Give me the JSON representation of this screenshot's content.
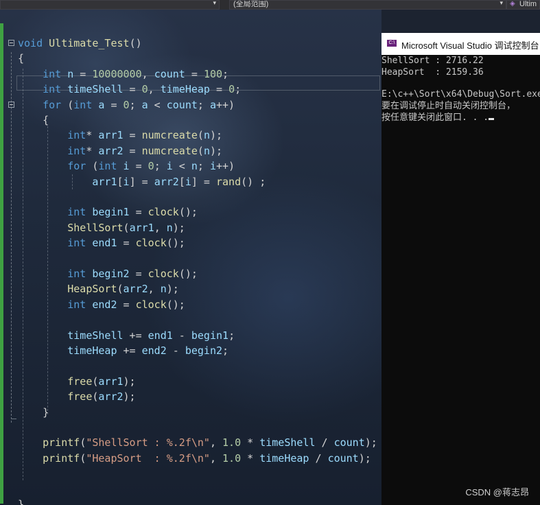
{
  "toolbar": {
    "scope_label": "(全局范围)",
    "project_label": "Ultim"
  },
  "editor": {
    "lines": [
      {
        "id": "l1",
        "parts": [
          [
            "k",
            "void"
          ],
          [
            "t",
            " "
          ],
          [
            "f",
            "Ultimate_Test"
          ],
          [
            "p",
            "()"
          ]
        ]
      },
      {
        "id": "l2",
        "parts": [
          [
            "p",
            "{"
          ]
        ]
      },
      {
        "id": "l3",
        "parts": [
          [
            "t",
            "    "
          ],
          [
            "k",
            "int"
          ],
          [
            "t",
            " "
          ],
          [
            "v",
            "n"
          ],
          [
            "p",
            " = "
          ],
          [
            "n",
            "10000000"
          ],
          [
            "p",
            ", "
          ],
          [
            "v",
            "count"
          ],
          [
            "p",
            " = "
          ],
          [
            "n",
            "100"
          ],
          [
            "p",
            ";"
          ]
        ]
      },
      {
        "id": "l4",
        "parts": [
          [
            "t",
            "    "
          ],
          [
            "k",
            "int"
          ],
          [
            "t",
            " "
          ],
          [
            "v",
            "timeShell"
          ],
          [
            "p",
            " = "
          ],
          [
            "n",
            "0"
          ],
          [
            "p",
            ", "
          ],
          [
            "v",
            "timeHeap"
          ],
          [
            "p",
            " = "
          ],
          [
            "n",
            "0"
          ],
          [
            "p",
            ";"
          ]
        ]
      },
      {
        "id": "l5",
        "parts": [
          [
            "t",
            "    "
          ],
          [
            "k",
            "for"
          ],
          [
            "p",
            " ("
          ],
          [
            "k",
            "int"
          ],
          [
            "t",
            " "
          ],
          [
            "v",
            "a"
          ],
          [
            "p",
            " = "
          ],
          [
            "n",
            "0"
          ],
          [
            "p",
            "; "
          ],
          [
            "v",
            "a"
          ],
          [
            "p",
            " < "
          ],
          [
            "v",
            "count"
          ],
          [
            "p",
            "; "
          ],
          [
            "v",
            "a"
          ],
          [
            "p",
            "++)"
          ]
        ]
      },
      {
        "id": "l6",
        "parts": [
          [
            "t",
            "    "
          ],
          [
            "p",
            "{"
          ]
        ]
      },
      {
        "id": "l7",
        "parts": [
          [
            "t",
            "        "
          ],
          [
            "k",
            "int"
          ],
          [
            "p",
            "* "
          ],
          [
            "v",
            "arr1"
          ],
          [
            "p",
            " = "
          ],
          [
            "f",
            "numcreate"
          ],
          [
            "p",
            "("
          ],
          [
            "v",
            "n"
          ],
          [
            "p",
            ");"
          ]
        ]
      },
      {
        "id": "l8",
        "parts": [
          [
            "t",
            "        "
          ],
          [
            "k",
            "int"
          ],
          [
            "p",
            "* "
          ],
          [
            "v",
            "arr2"
          ],
          [
            "p",
            " = "
          ],
          [
            "f",
            "numcreate"
          ],
          [
            "p",
            "("
          ],
          [
            "v",
            "n"
          ],
          [
            "p",
            ");"
          ]
        ]
      },
      {
        "id": "l9",
        "parts": [
          [
            "t",
            "        "
          ],
          [
            "k",
            "for"
          ],
          [
            "p",
            " ("
          ],
          [
            "k",
            "int"
          ],
          [
            "t",
            " "
          ],
          [
            "v",
            "i"
          ],
          [
            "p",
            " = "
          ],
          [
            "n",
            "0"
          ],
          [
            "p",
            "; "
          ],
          [
            "v",
            "i"
          ],
          [
            "p",
            " < "
          ],
          [
            "v",
            "n"
          ],
          [
            "p",
            "; "
          ],
          [
            "v",
            "i"
          ],
          [
            "p",
            "++)"
          ]
        ]
      },
      {
        "id": "l10",
        "parts": [
          [
            "t",
            "            "
          ],
          [
            "v",
            "arr1"
          ],
          [
            "p",
            "["
          ],
          [
            "v",
            "i"
          ],
          [
            "p",
            "] = "
          ],
          [
            "v",
            "arr2"
          ],
          [
            "p",
            "["
          ],
          [
            "v",
            "i"
          ],
          [
            "p",
            "] = "
          ],
          [
            "f",
            "rand"
          ],
          [
            "p",
            "() ;"
          ]
        ]
      },
      {
        "id": "l11",
        "parts": []
      },
      {
        "id": "l12",
        "parts": [
          [
            "t",
            "        "
          ],
          [
            "k",
            "int"
          ],
          [
            "t",
            " "
          ],
          [
            "v",
            "begin1"
          ],
          [
            "p",
            " = "
          ],
          [
            "f",
            "clock"
          ],
          [
            "p",
            "();"
          ]
        ]
      },
      {
        "id": "l13",
        "parts": [
          [
            "t",
            "        "
          ],
          [
            "f",
            "ShellSort"
          ],
          [
            "p",
            "("
          ],
          [
            "v",
            "arr1"
          ],
          [
            "p",
            ", "
          ],
          [
            "v",
            "n"
          ],
          [
            "p",
            ");"
          ]
        ]
      },
      {
        "id": "l14",
        "parts": [
          [
            "t",
            "        "
          ],
          [
            "k",
            "int"
          ],
          [
            "t",
            " "
          ],
          [
            "v",
            "end1"
          ],
          [
            "p",
            " = "
          ],
          [
            "f",
            "clock"
          ],
          [
            "p",
            "();"
          ]
        ]
      },
      {
        "id": "l15",
        "parts": []
      },
      {
        "id": "l16",
        "parts": [
          [
            "t",
            "        "
          ],
          [
            "k",
            "int"
          ],
          [
            "t",
            " "
          ],
          [
            "v",
            "begin2"
          ],
          [
            "p",
            " = "
          ],
          [
            "f",
            "clock"
          ],
          [
            "p",
            "();"
          ]
        ]
      },
      {
        "id": "l17",
        "parts": [
          [
            "t",
            "        "
          ],
          [
            "f",
            "HeapSort"
          ],
          [
            "p",
            "("
          ],
          [
            "v",
            "arr2"
          ],
          [
            "p",
            ", "
          ],
          [
            "v",
            "n"
          ],
          [
            "p",
            ");"
          ]
        ]
      },
      {
        "id": "l18",
        "parts": [
          [
            "t",
            "        "
          ],
          [
            "k",
            "int"
          ],
          [
            "t",
            " "
          ],
          [
            "v",
            "end2"
          ],
          [
            "p",
            " = "
          ],
          [
            "f",
            "clock"
          ],
          [
            "p",
            "();"
          ]
        ]
      },
      {
        "id": "l19",
        "parts": []
      },
      {
        "id": "l20",
        "parts": [
          [
            "t",
            "        "
          ],
          [
            "v",
            "timeShell"
          ],
          [
            "p",
            " += "
          ],
          [
            "v",
            "end1"
          ],
          [
            "p",
            " - "
          ],
          [
            "v",
            "begin1"
          ],
          [
            "p",
            ";"
          ]
        ]
      },
      {
        "id": "l21",
        "parts": [
          [
            "t",
            "        "
          ],
          [
            "v",
            "timeHeap"
          ],
          [
            "p",
            " += "
          ],
          [
            "v",
            "end2"
          ],
          [
            "p",
            " - "
          ],
          [
            "v",
            "begin2"
          ],
          [
            "p",
            ";"
          ]
        ]
      },
      {
        "id": "l22",
        "parts": []
      },
      {
        "id": "l23",
        "parts": [
          [
            "t",
            "        "
          ],
          [
            "f",
            "free"
          ],
          [
            "p",
            "("
          ],
          [
            "v",
            "arr1"
          ],
          [
            "p",
            ");"
          ]
        ]
      },
      {
        "id": "l24",
        "parts": [
          [
            "t",
            "        "
          ],
          [
            "f",
            "free"
          ],
          [
            "p",
            "("
          ],
          [
            "v",
            "arr2"
          ],
          [
            "p",
            ");"
          ]
        ]
      },
      {
        "id": "l25",
        "parts": [
          [
            "t",
            "    "
          ],
          [
            "p",
            "}"
          ]
        ]
      },
      {
        "id": "l26",
        "parts": []
      },
      {
        "id": "l27",
        "parts": [
          [
            "t",
            "    "
          ],
          [
            "f",
            "printf"
          ],
          [
            "p",
            "("
          ],
          [
            "s",
            "\"ShellSort : %.2f\\n\""
          ],
          [
            "p",
            ", "
          ],
          [
            "n",
            "1.0"
          ],
          [
            "p",
            " * "
          ],
          [
            "v",
            "timeShell"
          ],
          [
            "p",
            " / "
          ],
          [
            "v",
            "count"
          ],
          [
            "p",
            ");"
          ]
        ]
      },
      {
        "id": "l28",
        "parts": [
          [
            "t",
            "    "
          ],
          [
            "f",
            "printf"
          ],
          [
            "p",
            "("
          ],
          [
            "s",
            "\"HeapSort  : %.2f\\n\""
          ],
          [
            "p",
            ", "
          ],
          [
            "n",
            "1.0"
          ],
          [
            "p",
            " * "
          ],
          [
            "v",
            "timeHeap"
          ],
          [
            "p",
            " / "
          ],
          [
            "v",
            "count"
          ],
          [
            "p",
            ");"
          ]
        ]
      },
      {
        "id": "l29",
        "parts": []
      },
      {
        "id": "l30",
        "parts": []
      },
      {
        "id": "l31",
        "parts": [
          [
            "p",
            "}"
          ]
        ]
      }
    ]
  },
  "console": {
    "title": "Microsoft Visual Studio 调试控制台",
    "icon_text": "C:\\",
    "lines": [
      "ShellSort : 2716.22",
      "HeapSort  : 2159.36",
      "",
      "E:\\c++\\Sort\\x64\\Debug\\Sort.exe",
      "要在调试停止时自动关闭控制台，",
      "按任意键关闭此窗口. . ."
    ]
  },
  "watermark": "CSDN @蒋志昂"
}
